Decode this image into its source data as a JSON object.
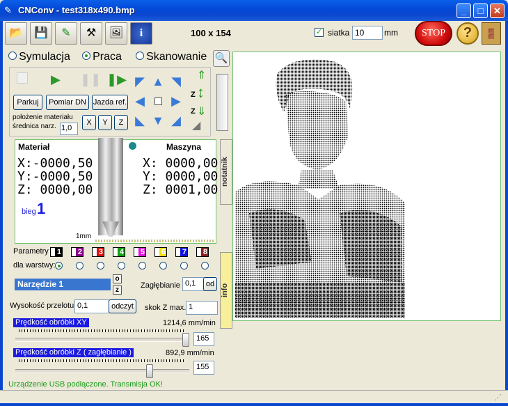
{
  "window": {
    "title": "CNConv - test318x490.bmp",
    "minimize": "_",
    "maximize": "□",
    "close": "✕"
  },
  "toolbar": {
    "dimensions": "100 x 154",
    "grid_label": "siatka",
    "grid_checked": true,
    "grid_value": "10",
    "grid_unit": "mm",
    "stop_label": "STOP",
    "help_label": "?",
    "icons": [
      "open-folder-icon",
      "save-disk-icon",
      "plt-tools-icon",
      "settings-tools-icon",
      "image-icon",
      "info-icon"
    ]
  },
  "modes": {
    "items": [
      {
        "label": "Symulacja",
        "selected": false
      },
      {
        "label": "Praca",
        "selected": true
      },
      {
        "label": "Skanowanie",
        "selected": false
      }
    ]
  },
  "controls": {
    "parkuj": "Parkuj",
    "pomiar": "Pomiar DN",
    "jazda": "Jazda ref.",
    "material_pos": "położenie materiału",
    "diameter_label": "średnica narz.",
    "diameter_value": "1,0",
    "x_btn": "X",
    "y_btn": "Y",
    "z_btn": "Z",
    "z_label": "Z"
  },
  "coords": {
    "material_label": "Materiał",
    "machine_label": "Maszyna",
    "mat_x": "X:-0000,50",
    "mat_y": "Y:-0000,50",
    "mat_z": "Z: 0000,00",
    "mach_x": "X: 0000,00",
    "mach_y": "Y: 0000,00",
    "mach_z": "Z: 0001,00",
    "bieg_label": "bieg",
    "bieg_value": "1",
    "scale_label": "1mm"
  },
  "side_tabs": {
    "notatnik": "notatnik",
    "info": "info"
  },
  "parameters": {
    "label": "Parametry",
    "layers_label": "dla warstwy:",
    "swatches": [
      {
        "num": "1",
        "color": "#000000"
      },
      {
        "num": "2",
        "color": "#8b008b"
      },
      {
        "num": "3",
        "color": "#e01010"
      },
      {
        "num": "4",
        "color": "#10a010"
      },
      {
        "num": "5",
        "color": "#e010e0"
      },
      {
        "num": "6",
        "color": "#f0e010"
      },
      {
        "num": "7",
        "color": "#1010e0"
      },
      {
        "num": "8",
        "color": "#8b2020"
      }
    ]
  },
  "tool": {
    "name": "Narzędzie 1",
    "spin_up": "o",
    "spin_down": "z",
    "depth_label": "Zagłębianie",
    "depth_value": "0,1",
    "depth_unit": "od",
    "pass_label": "Wysokość przelotu",
    "pass_value": "0,1",
    "read_btn": "odczyt",
    "zmax_label": "skok Z max.",
    "zmax_value": "1"
  },
  "speeds": {
    "xy_label": "Prędkość obróbki  XY",
    "xy_value": "1214,6 mm/min",
    "xy_slider": "165",
    "z_label": "Prędkość obróbki  Z  ( zagłębianie )",
    "z_value": "892,9 mm/min",
    "z_slider": "155"
  },
  "status": {
    "text": "Urządzenie USB podłączone. Transmisja OK!"
  }
}
